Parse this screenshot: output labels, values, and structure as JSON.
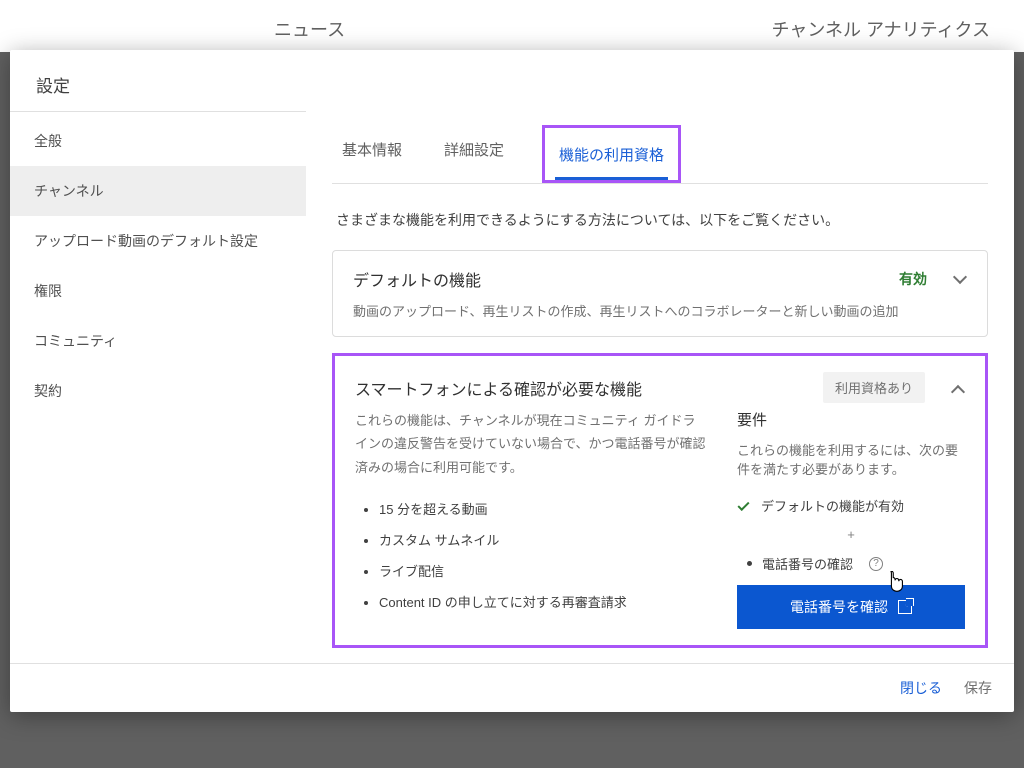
{
  "bg": {
    "tabs": [
      "ニュース",
      "チャンネル アナリティクス"
    ]
  },
  "modal": {
    "title": "設定",
    "sidebar": [
      "全般",
      "チャンネル",
      "アップロード動画のデフォルト設定",
      "権限",
      "コミュニティ",
      "契約"
    ],
    "tabs": [
      "基本情報",
      "詳細設定",
      "機能の利用資格"
    ],
    "intro": "さまざまな機能を利用できるようにする方法については、以下をご覧ください。",
    "card_default": {
      "title": "デフォルトの機能",
      "subtitle": "動画のアップロード、再生リストの作成、再生リストへのコラボレーターと新しい動画の追加",
      "badge": "有効"
    },
    "card_phone": {
      "title": "スマートフォンによる確認が必要な機能",
      "badge": "利用資格あり",
      "desc": "これらの機能は、チャンネルが現在コミュニティ ガイドラインの違反警告を受けていない場合で、かつ電話番号が確認済みの場合に利用可能です。",
      "bullets": [
        "15 分を超える動画",
        "カスタム サムネイル",
        "ライブ配信",
        "Content ID の申し立てに対する再審査請求"
      ],
      "req_title": "要件",
      "req_desc": "これらの機能を利用するには、次の要件を満たす必要があります。",
      "req_ok": "デフォルトの機能が有効",
      "req_plus": "+",
      "req_need": "電話番号の確認",
      "button": "電話番号を確認"
    },
    "footer": {
      "close": "閉じる",
      "save": "保存"
    }
  }
}
